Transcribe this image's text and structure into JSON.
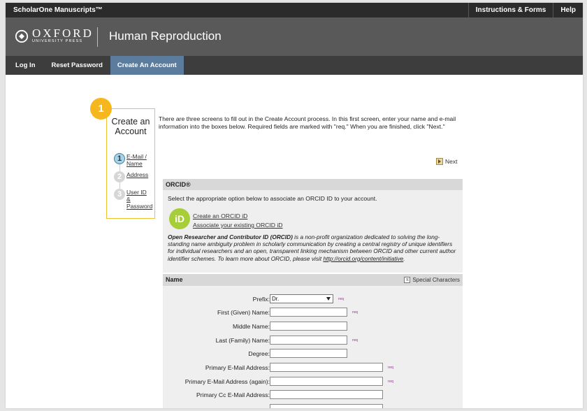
{
  "topbar": {
    "brand": "ScholarOne Manuscripts™",
    "links": [
      "Instructions & Forms",
      "Help"
    ]
  },
  "header": {
    "logo_main": "OXFORD",
    "logo_sub": "UNIVERSITY PRESS",
    "journal": "Human Reproduction"
  },
  "nav": {
    "items": [
      "Log In",
      "Reset Password",
      "Create An Account"
    ],
    "active": "Create An Account"
  },
  "marker": "1",
  "steps": {
    "title_line1": "Create an",
    "title_line2": "Account",
    "items": [
      {
        "num": "1",
        "line1": "E-Mail /",
        "line2": "Name",
        "line3": ""
      },
      {
        "num": "2",
        "line1": "Address",
        "line2": "",
        "line3": ""
      },
      {
        "num": "3",
        "line1": "User ID",
        "line2": "&",
        "line3": "Password"
      }
    ]
  },
  "intro": "There are three screens to fill out in the Create Account process. In this first screen, enter your name and e-mail information into the boxes below. Required fields are marked with \"req.\" When you are finished, click \"Next.\"",
  "next_label": "Next",
  "orcid": {
    "heading": "ORCID®",
    "prompt": "Select the appropriate option below to associate an ORCID ID to your account.",
    "logo": "iD",
    "create_link": "Create an ORCID iD",
    "associate_link": "Associate your existing ORCID iD",
    "desc_bold": "Open Researcher and Contributor ID (ORCID)",
    "desc_body": " is a non-profit organization dedicated to solving the long-standing name ambiguity problem in scholarly communication by creating a central registry of unique identifiers for individual researchers and an open, transparent linking mechanism between ORCID and other current author identifier schemes. To learn more about ORCID, please visit ",
    "desc_url": "http://orcid.org/content/initiative",
    "desc_end": "."
  },
  "name_section": {
    "heading": "Name",
    "special": "Special Characters",
    "special_icon": "π",
    "req": "req",
    "prefix_label": "Prefix:",
    "prefix_value": "Dr.",
    "first_label": "First (Given) Name:",
    "middle_label": "Middle Name:",
    "last_label": "Last (Family) Name:",
    "degree_label": "Degree:",
    "email_label": "Primary E-Mail Address:",
    "email_again_label": "Primary E-Mail Address (again):",
    "cc_label": "Primary Cc E-Mail Address:"
  }
}
